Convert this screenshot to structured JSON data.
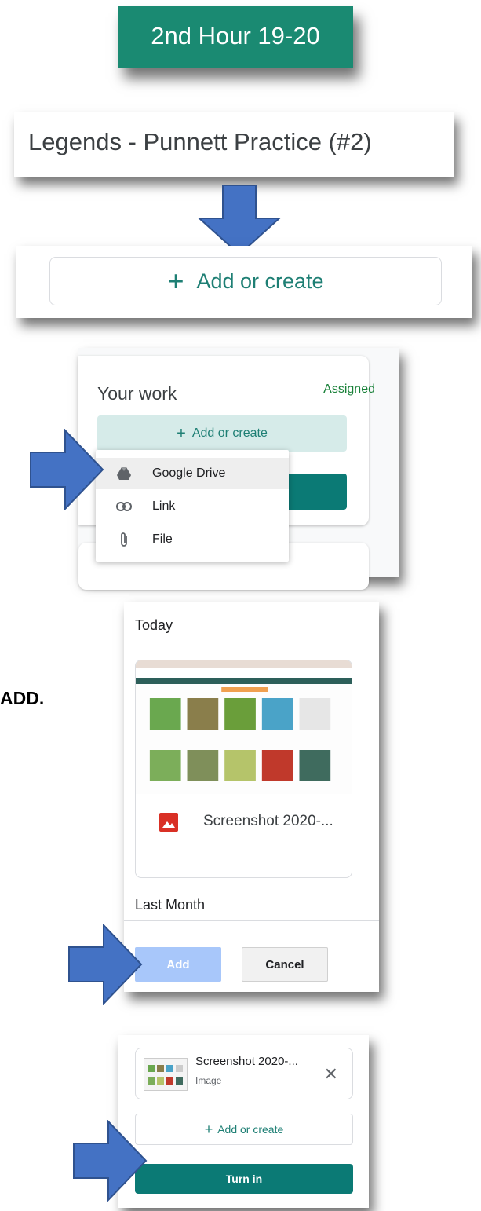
{
  "class_header": {
    "title": "2nd Hour 19-20"
  },
  "assignment": {
    "title": "Legends - Punnett Practice (#2)"
  },
  "add_or_create_large": {
    "label": "Add or create"
  },
  "your_work_panel": {
    "heading": "Your work",
    "status": "Assigned",
    "add_label": "Add or create",
    "menu": [
      {
        "label": "Google Drive",
        "icon": "google-drive-icon"
      },
      {
        "label": "Link",
        "icon": "link-icon"
      },
      {
        "label": "File",
        "icon": "paperclip-icon"
      }
    ]
  },
  "instruction_fragment": "ADD.",
  "drive_picker": {
    "section_today": "Today",
    "file_name": "Screenshot 2020-...",
    "section_last_month": "Last Month",
    "add_label": "Add",
    "cancel_label": "Cancel"
  },
  "turn_in_panel": {
    "attachment_name": "Screenshot 2020-...",
    "attachment_type": "Image",
    "add_label": "Add or create",
    "turn_in_label": "Turn in"
  },
  "colors": {
    "arrow": "#4472c4",
    "teal": "#1a8a72",
    "accent_text": "#1e7f74"
  }
}
